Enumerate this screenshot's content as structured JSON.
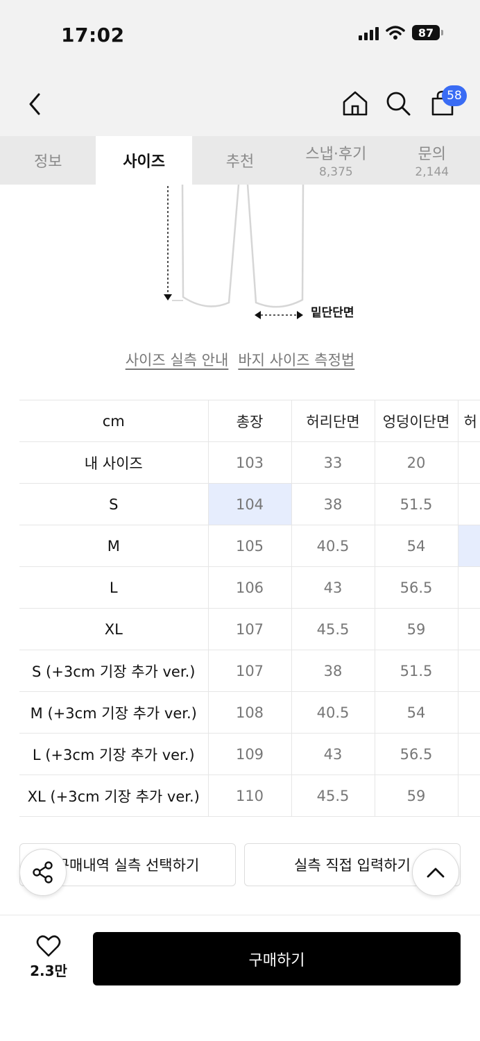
{
  "status_bar": {
    "time": "17:02",
    "battery": "87"
  },
  "header": {
    "cart_badge": "58"
  },
  "tabs": [
    {
      "label": "정보",
      "count": ""
    },
    {
      "label": "사이즈",
      "count": ""
    },
    {
      "label": "추천",
      "count": ""
    },
    {
      "label": "스냅·후기",
      "count": "8,375"
    },
    {
      "label": "문의",
      "count": "2,144"
    }
  ],
  "diagram": {
    "hem_label": "밑단단면"
  },
  "guide_links": {
    "measure_guide": "사이즈 실측 안내",
    "pants_method": "바지 사이즈 측정법"
  },
  "size_table": {
    "headers": [
      "cm",
      "총장",
      "허리단면",
      "엉덩이단면",
      "허"
    ],
    "rows": [
      [
        "내 사이즈",
        "103",
        "33",
        "20"
      ],
      [
        "S",
        "104",
        "38",
        "51.5"
      ],
      [
        "M",
        "105",
        "40.5",
        "54"
      ],
      [
        "L",
        "106",
        "43",
        "56.5"
      ],
      [
        "XL",
        "107",
        "45.5",
        "59"
      ],
      [
        "S (+3cm 기장 추가 ver.)",
        "107",
        "38",
        "51.5"
      ],
      [
        "M (+3cm 기장 추가 ver.)",
        "108",
        "40.5",
        "54"
      ],
      [
        "L (+3cm 기장 추가 ver.)",
        "109",
        "43",
        "56.5"
      ],
      [
        "XL (+3cm 기장 추가 ver.)",
        "110",
        "45.5",
        "59"
      ]
    ]
  },
  "actions": {
    "purchase_history_select": "구매내역 실측 선택하기",
    "manual_input": "실측 직접 입력하기"
  },
  "bottom_bar": {
    "like_count": "2.3만",
    "buy_label": "구매하기"
  },
  "colors": {
    "highlight": "#e6edfd",
    "badge": "#3a6cf4",
    "buy_button": "#000000"
  }
}
